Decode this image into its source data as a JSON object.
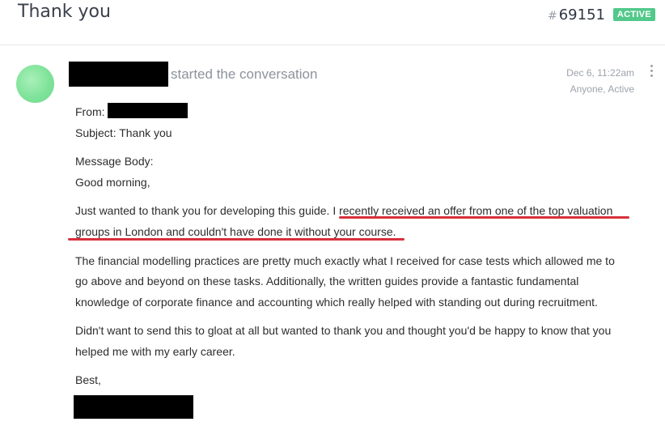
{
  "header": {
    "title": "Thank you",
    "ticket_hash": "#",
    "ticket_number": "69151",
    "status": "ACTIVE",
    "status_color": "#52c98a"
  },
  "conversation": {
    "action": "started the conversation",
    "date": "Dec 6, 11:22am",
    "visibility": "Anyone, Active",
    "menu_icon": "kebab-menu-icon",
    "avatar_color": "#7fe39a"
  },
  "message": {
    "from_label": "From:",
    "subject": "Subject: Thank you",
    "body_label": "Message Body:",
    "greeting": "Good morning,",
    "p1_line1_a": "Just wanted to thank you for developing this guide.",
    "p1_line1_b": "I recently received an offer from one of the top valuation",
    "p1_line2": "groups in London and couldn't have done it without your course.",
    "p2_line1": "The financial modelling practices are pretty much exactly what I received for case tests which allowed me to",
    "p2_line2": "go above and beyond on these tasks. Additionally, the written guides provide a fantastic fundamental",
    "p2_line3": "knowledge of corporate finance and accounting which really helped with standing out during recruitment.",
    "p3_line1": "Didn't want to send this to gloat at all but wanted to thank you and thought you'd be happy to know that you",
    "p3_line2": "helped me with my early career.",
    "signoff": "Best,",
    "highlight_color": "#d9303c"
  }
}
